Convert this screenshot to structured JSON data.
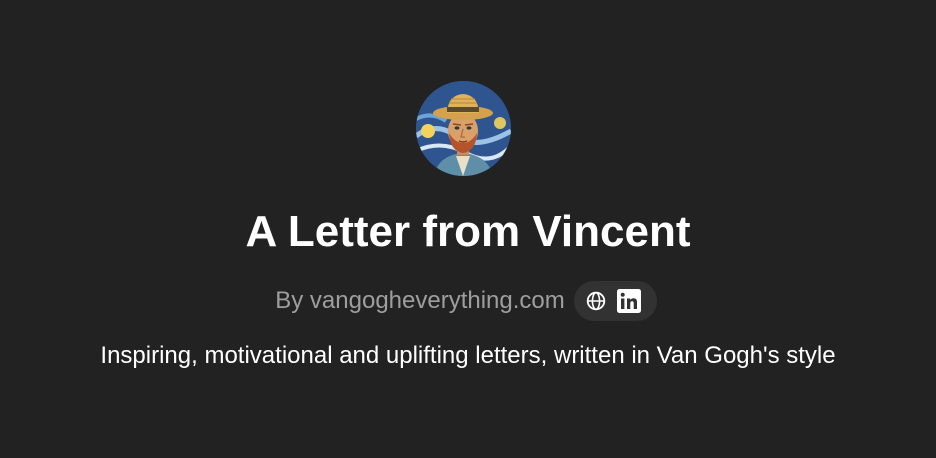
{
  "header": {
    "avatar_icon": "van-gogh-portrait-avatar",
    "title": "A Letter from Vincent",
    "byline": "By vangogheverything.com",
    "links": [
      {
        "icon": "globe-icon"
      },
      {
        "icon": "linkedin-icon"
      }
    ],
    "tagline": "Inspiring, motivational and uplifting letters, written in Van Gogh's style"
  },
  "colors": {
    "background": "#222222",
    "title": "#ffffff",
    "byline": "#9e9e9e",
    "pill": "#323232"
  }
}
